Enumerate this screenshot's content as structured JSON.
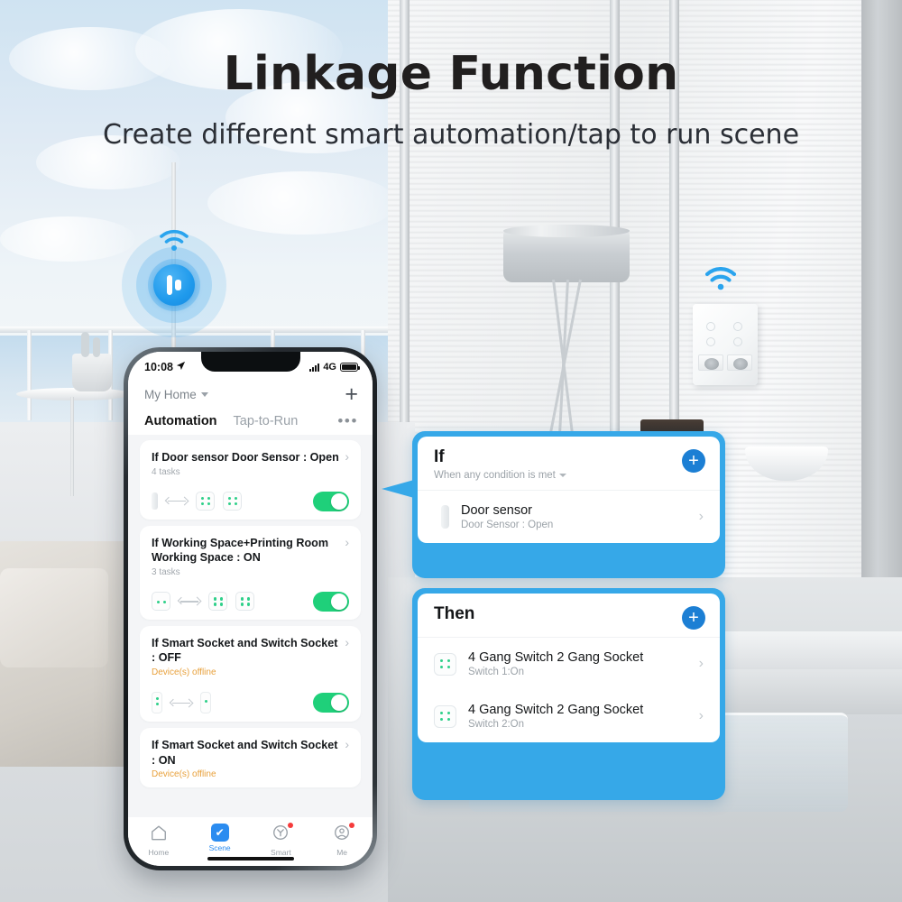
{
  "hero": {
    "title": "Linkage Function",
    "subtitle": "Create different smart automation/tap to run scene"
  },
  "colors": {
    "accent_blue": "#36a8e8",
    "callout_add_blue": "#1c7fd4",
    "toggle_green": "#1fd07a",
    "offline_orange": "#e8a13c",
    "tab_active_blue": "#2b8cf0"
  },
  "phone": {
    "status_bar": {
      "time": "10:08",
      "location_icon": "location-arrow-icon",
      "signal_icon": "signal-bars-icon",
      "network": "4G",
      "battery_icon": "battery-icon"
    },
    "header": {
      "home_name": "My Home",
      "home_caret_icon": "chevron-down-icon",
      "add_icon": "plus-icon",
      "tabs": [
        {
          "label": "Automation",
          "active": true
        },
        {
          "label": "Tap-to-Run",
          "active": false
        }
      ],
      "more_icon": "ellipsis-icon"
    },
    "automations": [
      {
        "title": "If Door sensor Door Sensor : Open",
        "subtitle": "4 tasks",
        "offline": false,
        "enabled": true,
        "devices": [
          "door-sensor-icon",
          "arrow-right-icon",
          "gang-switch-icon",
          "gang-switch-icon"
        ]
      },
      {
        "title": "If Working Space+Printing Room Working Space : ON",
        "subtitle": "3 tasks",
        "offline": false,
        "enabled": true,
        "devices": [
          "two-dot-switch-icon",
          "arrow-right-icon",
          "gang-switch-icon",
          "gang-switch-icon"
        ]
      },
      {
        "title": "If Smart Socket and Switch Socket : OFF",
        "subtitle": "Device(s) offline",
        "offline": true,
        "enabled": true,
        "devices": [
          "socket-icon",
          "arrow-right-icon",
          "socket-icon"
        ]
      },
      {
        "title": "If Smart Socket and Switch Socket : ON",
        "subtitle": "Device(s) offline",
        "offline": true,
        "enabled": true,
        "devices": []
      }
    ],
    "tabbar": [
      {
        "label": "Home",
        "icon": "home-icon",
        "active": false,
        "badge": false
      },
      {
        "label": "Scene",
        "icon": "scene-check-icon",
        "active": true,
        "badge": false
      },
      {
        "label": "Smart",
        "icon": "smart-clock-icon",
        "active": false,
        "badge": true
      },
      {
        "label": "Me",
        "icon": "profile-icon",
        "active": false,
        "badge": true
      }
    ]
  },
  "callouts": {
    "if_card": {
      "title": "If",
      "condition": "When any condition is met",
      "condition_caret_icon": "chevron-down-icon",
      "add_icon": "plus-icon",
      "rows": [
        {
          "icon": "door-sensor-icon",
          "title": "Door sensor",
          "subtitle": "Door Sensor : Open",
          "chevron_icon": "chevron-right-icon"
        }
      ]
    },
    "then_card": {
      "title": "Then",
      "add_icon": "plus-icon",
      "rows": [
        {
          "icon": "gang-switch-icon",
          "title": "4 Gang Switch 2 Gang Socket",
          "subtitle": "Switch 1:On",
          "chevron_icon": "chevron-right-icon"
        },
        {
          "icon": "gang-switch-icon",
          "title": "4 Gang Switch 2 Gang Socket",
          "subtitle": "Switch 2:On",
          "chevron_icon": "chevron-right-icon"
        }
      ]
    }
  },
  "scene": {
    "door_sensor_beacon_icon": "door-sensor-beacon-icon",
    "wifi_icon": "wifi-icon",
    "wall_switch_panel": "4-gang-switch-2-gang-socket-panel"
  }
}
